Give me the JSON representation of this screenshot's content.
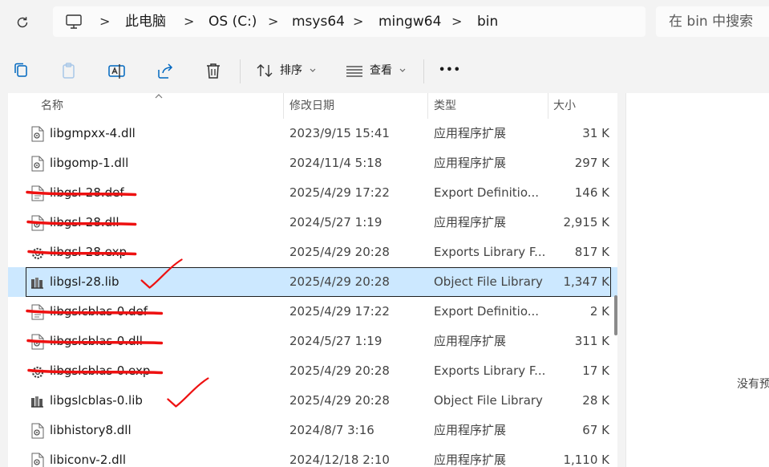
{
  "address_bar": {
    "crumbs": [
      "此电脑",
      "OS (C:)",
      "msys64",
      "mingw64",
      "bin"
    ],
    "separator": ">"
  },
  "search": {
    "placeholder": "在 bin 中搜索"
  },
  "toolbar": {
    "sort_label": "排序",
    "view_label": "查看",
    "more_label": "•••"
  },
  "columns": {
    "name": "名称",
    "date": "修改日期",
    "type": "类型",
    "size": "大小"
  },
  "files": [
    {
      "name": "libgmpxx-4.dll",
      "date": "2023/9/15 15:41",
      "type": "应用程序扩展",
      "size": "31 K",
      "icon": "dll-icon"
    },
    {
      "name": "libgomp-1.dll",
      "date": "2024/11/4 5:18",
      "type": "应用程序扩展",
      "size": "297 K",
      "icon": "dll-icon"
    },
    {
      "name": "libgsl-28.def",
      "date": "2025/4/29 17:22",
      "type": "Export Definitio...",
      "size": "146 K",
      "icon": "def-icon"
    },
    {
      "name": "libgsl-28.dll",
      "date": "2024/5/27 1:19",
      "type": "应用程序扩展",
      "size": "2,915 K",
      "icon": "dll-icon"
    },
    {
      "name": "libgsl-28.exp",
      "date": "2025/4/29 20:28",
      "type": "Exports Library F...",
      "size": "817 K",
      "icon": "exp-icon"
    },
    {
      "name": "libgsl-28.lib",
      "date": "2025/4/29 20:28",
      "type": "Object File Library",
      "size": "1,347 K",
      "icon": "lib-icon"
    },
    {
      "name": "libgslcblas-0.def",
      "date": "2025/4/29 17:22",
      "type": "Export Definitio...",
      "size": "2 K",
      "icon": "def-icon"
    },
    {
      "name": "libgslcblas-0.dll",
      "date": "2024/5/27 1:19",
      "type": "应用程序扩展",
      "size": "311 K",
      "icon": "dll-icon"
    },
    {
      "name": "libgslcblas-0.exp",
      "date": "2025/4/29 20:28",
      "type": "Exports Library F...",
      "size": "17 K",
      "icon": "exp-icon"
    },
    {
      "name": "libgslcblas-0.lib",
      "date": "2025/4/29 20:28",
      "type": "Object File Library",
      "size": "28 K",
      "icon": "lib-icon"
    },
    {
      "name": "libhistory8.dll",
      "date": "2024/8/7 3:16",
      "type": "应用程序扩展",
      "size": "67 K",
      "icon": "dll-icon"
    },
    {
      "name": "libiconv-2.dll",
      "date": "2024/12/18 2:10",
      "type": "应用程序扩展",
      "size": "1,110 K",
      "icon": "dll-icon"
    }
  ],
  "selected_file": "libgsl-28.lib",
  "annotations": {
    "struck_through": [
      "libgsl-28.def",
      "libgsl-28.dll",
      "libgsl-28.exp",
      "libgslcblas-0.def",
      "libgslcblas-0.dll",
      "libgslcblas-0.exp"
    ],
    "checkmarked": [
      "libgsl-28.lib",
      "libgslcblas-0.lib"
    ],
    "ink_color": "#ee1111"
  },
  "preview_pane": {
    "text": "没有预"
  },
  "colors": {
    "selection": "#cce8ff",
    "accent": "#0067c0"
  }
}
